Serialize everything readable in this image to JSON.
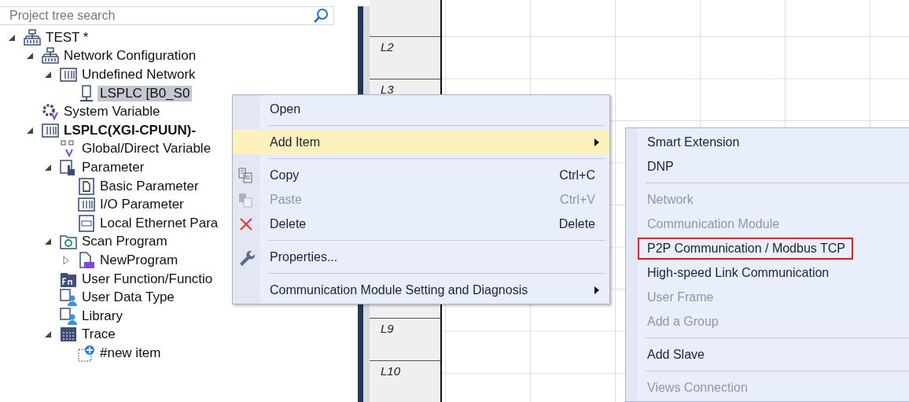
{
  "search": {
    "placeholder": "Project tree search"
  },
  "tree": [
    {
      "label": "TEST *",
      "kind": "network",
      "expanded": true,
      "children": [
        {
          "label": "Network Configuration",
          "kind": "network",
          "expanded": true,
          "children": [
            {
              "label": "Undefined Network",
              "kind": "rack",
              "expanded": true,
              "children": [
                {
                  "label": "LSPLC [B0_S0",
                  "kind": "station",
                  "selected": true
                }
              ]
            }
          ]
        },
        {
          "label": "System Variable",
          "kind": "sysvar",
          "selected": false
        },
        {
          "label": "LSPLC(XGI-CPUUN)-",
          "kind": "rack",
          "bold": true,
          "expanded": true,
          "children": [
            {
              "label": "Global/Direct Variable",
              "kind": "globalvar",
              "selected": false
            },
            {
              "label": "Parameter",
              "kind": "parameter",
              "expanded": true,
              "children": [
                {
                  "label": "Basic Parameter",
                  "kind": "doc",
                  "selected": false
                },
                {
                  "label": "I/O Parameter",
                  "kind": "io",
                  "selected": false
                },
                {
                  "label": "Local Ethernet Para",
                  "kind": "ethernet",
                  "selected": false
                }
              ]
            },
            {
              "label": "Scan Program",
              "kind": "scan",
              "expanded": true,
              "children": [
                {
                  "label": "NewProgram",
                  "kind": "ld",
                  "expanded": false,
                  "selected": false
                }
              ]
            },
            {
              "label": "User Function/Functio",
              "kind": "fn",
              "selected": false
            },
            {
              "label": "User Data Type",
              "kind": "datatype",
              "selected": false
            },
            {
              "label": "Library",
              "kind": "library",
              "selected": false
            },
            {
              "label": "Trace",
              "kind": "trace",
              "expanded": true,
              "children": [
                {
                  "label": "#new item",
                  "kind": "newitem",
                  "selected": false
                }
              ]
            }
          ]
        }
      ]
    }
  ],
  "ladder": {
    "top_rows": [
      "L2",
      "L3"
    ],
    "bottom_rows": [
      "L9",
      "L10"
    ]
  },
  "context_menu": [
    {
      "kind": "plain",
      "label": "Open",
      "highlighted": false,
      "disabled": false
    },
    {
      "kind": "separator"
    },
    {
      "kind": "plain",
      "label": "Add Item",
      "highlighted": true,
      "disabled": false,
      "submenu": true
    },
    {
      "kind": "separator"
    },
    {
      "kind": "copy",
      "label": "Copy",
      "shortcut": "Ctrl+C",
      "highlighted": false,
      "disabled": false
    },
    {
      "kind": "paste",
      "label": "Paste",
      "shortcut": "Ctrl+V",
      "highlighted": false,
      "disabled": true
    },
    {
      "kind": "delete",
      "label": "Delete",
      "shortcut": "Delete",
      "highlighted": false,
      "disabled": false
    },
    {
      "kind": "separator"
    },
    {
      "kind": "properties",
      "label": "Properties...",
      "highlighted": false,
      "disabled": false
    },
    {
      "kind": "separator"
    },
    {
      "kind": "plain",
      "label": "Communication Module Setting and Diagnosis",
      "highlighted": false,
      "disabled": false,
      "submenu": true
    }
  ],
  "submenu": [
    {
      "kind": "item",
      "label": "Smart Extension",
      "disabled": false,
      "outlined": false
    },
    {
      "kind": "item",
      "label": "DNP",
      "disabled": false,
      "outlined": false
    },
    {
      "kind": "separator"
    },
    {
      "kind": "item",
      "label": "Network",
      "disabled": true,
      "outlined": false
    },
    {
      "kind": "item",
      "label": "Communication Module",
      "disabled": true,
      "outlined": false
    },
    {
      "kind": "item",
      "label": "P2P Communication / Modbus TCP",
      "disabled": false,
      "outlined": true
    },
    {
      "kind": "item",
      "label": "High-speed Link Communication",
      "disabled": false,
      "outlined": false
    },
    {
      "kind": "item",
      "label": "User Frame",
      "disabled": true,
      "outlined": false
    },
    {
      "kind": "item",
      "label": "Add a Group",
      "disabled": true,
      "outlined": false
    },
    {
      "kind": "separator"
    },
    {
      "kind": "item",
      "label": "Add Slave",
      "disabled": false,
      "outlined": false
    },
    {
      "kind": "separator"
    },
    {
      "kind": "item",
      "label": "Views Connection",
      "disabled": true,
      "outlined": false
    }
  ]
}
